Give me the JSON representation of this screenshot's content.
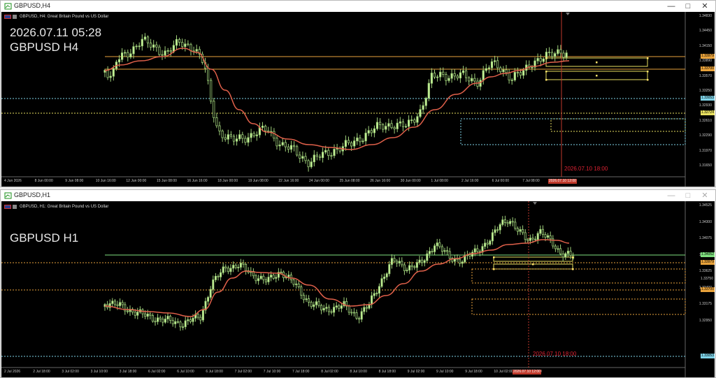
{
  "h4": {
    "window_title": "GBPUSD,H4",
    "header": "GBPUSD, H4:  Great Britain Pound vs US Dollar",
    "datetime": "2026.07.11 05:28",
    "symbol_tf": "GBPUSD H4",
    "prices": [
      "1.34830",
      "1.34450",
      "1.34150",
      "1.33890",
      "1.33570",
      "1.33250",
      "1.32930",
      "1.32610",
      "1.32290",
      "1.31970",
      "1.31650"
    ],
    "tags": [
      {
        "text": "1.33979",
        "color": "#e8a23b"
      },
      {
        "text": "1.33700",
        "color": "#e8a23b"
      },
      {
        "text": "1.33053",
        "color": "#7fd3e8"
      },
      {
        "text": "1.32724",
        "color": "#e8e060"
      }
    ],
    "times": [
      "4 Jun 2026",
      "8 Jun 00:00",
      "9 Jun 08:00",
      "10 Jun 16:00",
      "12 Jun 00:00",
      "15 Jun 08:00",
      "16 Jun 16:00",
      "18 Jun 00:00",
      "19 Jun 08:00",
      "22 Jun 16:00",
      "24 Jun 00:00",
      "25 Jun 08:00",
      "26 Jun 16:00",
      "30 Jun 00:00",
      "1 Jul 08:00",
      "2 Jul 16:00",
      "6 Jul 00:00",
      "7 Jul 08:00",
      "8 Jul 16:00"
    ],
    "vline_tag": "2026.07.10 12:00",
    "vline_text": "2026.07.10 18:00"
  },
  "h1": {
    "window_title": "GBPUSD,H1",
    "header": "GBPUSD, H1:  Great Britain Pound vs US Dollar",
    "symbol_tf": "GBPUSD H1",
    "prices": [
      "1.34525",
      "1.34300",
      "1.34075",
      "1.33850",
      "1.33625",
      "1.33400",
      "1.33175",
      "1.32950"
    ],
    "tags": [
      {
        "text": "1.34052",
        "color": "#7fe07f"
      },
      {
        "text": "1.33979",
        "color": "#e8a23b"
      },
      {
        "text": "1.33700",
        "color": "#e8a23b"
      },
      {
        "text": "1.33053",
        "color": "#7fd3e8"
      }
    ],
    "extra_price": "1.33750",
    "times": [
      "2 Jul 2026",
      "2 Jul 18:00",
      "3 Jul 02:00",
      "3 Jul 10:00",
      "3 Jul 18:00",
      "6 Jul 02:00",
      "6 Jul 10:00",
      "6 Jul 18:00",
      "7 Jul 02:00",
      "7 Jul 10:00",
      "7 Jul 18:00",
      "8 Jul 02:00",
      "8 Jul 10:00",
      "8 Jul 18:00",
      "9 Jul 02:00",
      "9 Jul 10:00",
      "9 Jul 18:00",
      "10 Jul 02:00",
      "10 Jul 18:00"
    ],
    "vline_tag": "2026.07.10 12:00",
    "vline_text": "2026.07.10 18:00"
  },
  "icons": {
    "minimize": "minimize-icon",
    "maximize": "maximize-icon",
    "close": "close-icon"
  },
  "colors": {
    "bull": "#b8f088",
    "ma": "#e0604a",
    "orange": "#e8a23b",
    "cyan": "#7fd3e8",
    "yellow": "#e8e060",
    "green": "#7fe07f",
    "red": "#d23"
  }
}
